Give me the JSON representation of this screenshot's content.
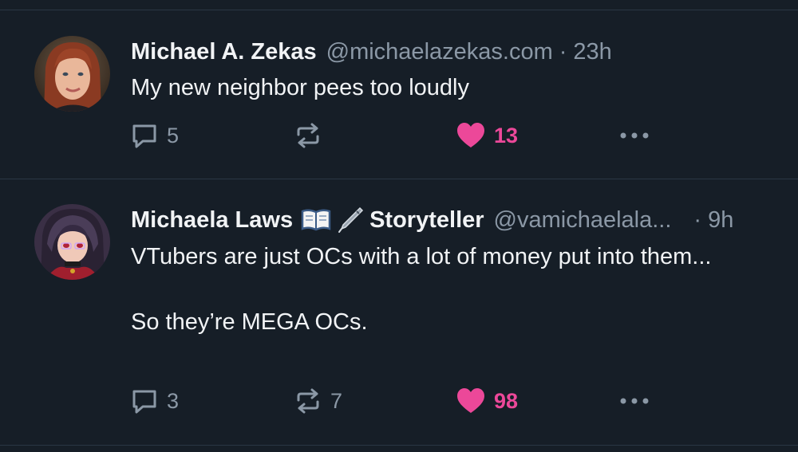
{
  "posts": [
    {
      "author_name": "Michael A. Zekas",
      "handle": "@michaelazekas.com",
      "separator": "·",
      "time": "23h",
      "text": "My new neighbor pees too loudly",
      "avatar_icon": "avatar-photo-red-hair",
      "replies": "5",
      "reposts": "",
      "likes": "13",
      "liked": true
    },
    {
      "author_name_part1": "Michaela Laws",
      "author_name_part2": "Storyteller",
      "name_emojis": [
        "open-book-emoji",
        "pen-emoji"
      ],
      "handle": "@vamichaelala...",
      "separator": "·",
      "time": "9h",
      "text": "VTubers are just OCs with a lot of money put into them...\n\nSo they’re MEGA OCs.",
      "avatar_icon": "avatar-anime-character",
      "replies": "3",
      "reposts": "7",
      "likes": "98",
      "liked": true
    }
  ],
  "colors": {
    "background": "#161e27",
    "divider": "#2a3644",
    "text_primary": "#f1f3f5",
    "text_secondary": "#8b98a6",
    "like_pink": "#ec4899"
  },
  "icons": {
    "reply": "speech-bubble-icon",
    "repost": "repost-arrows-icon",
    "like": "heart-icon",
    "more": "more-dots-icon"
  }
}
